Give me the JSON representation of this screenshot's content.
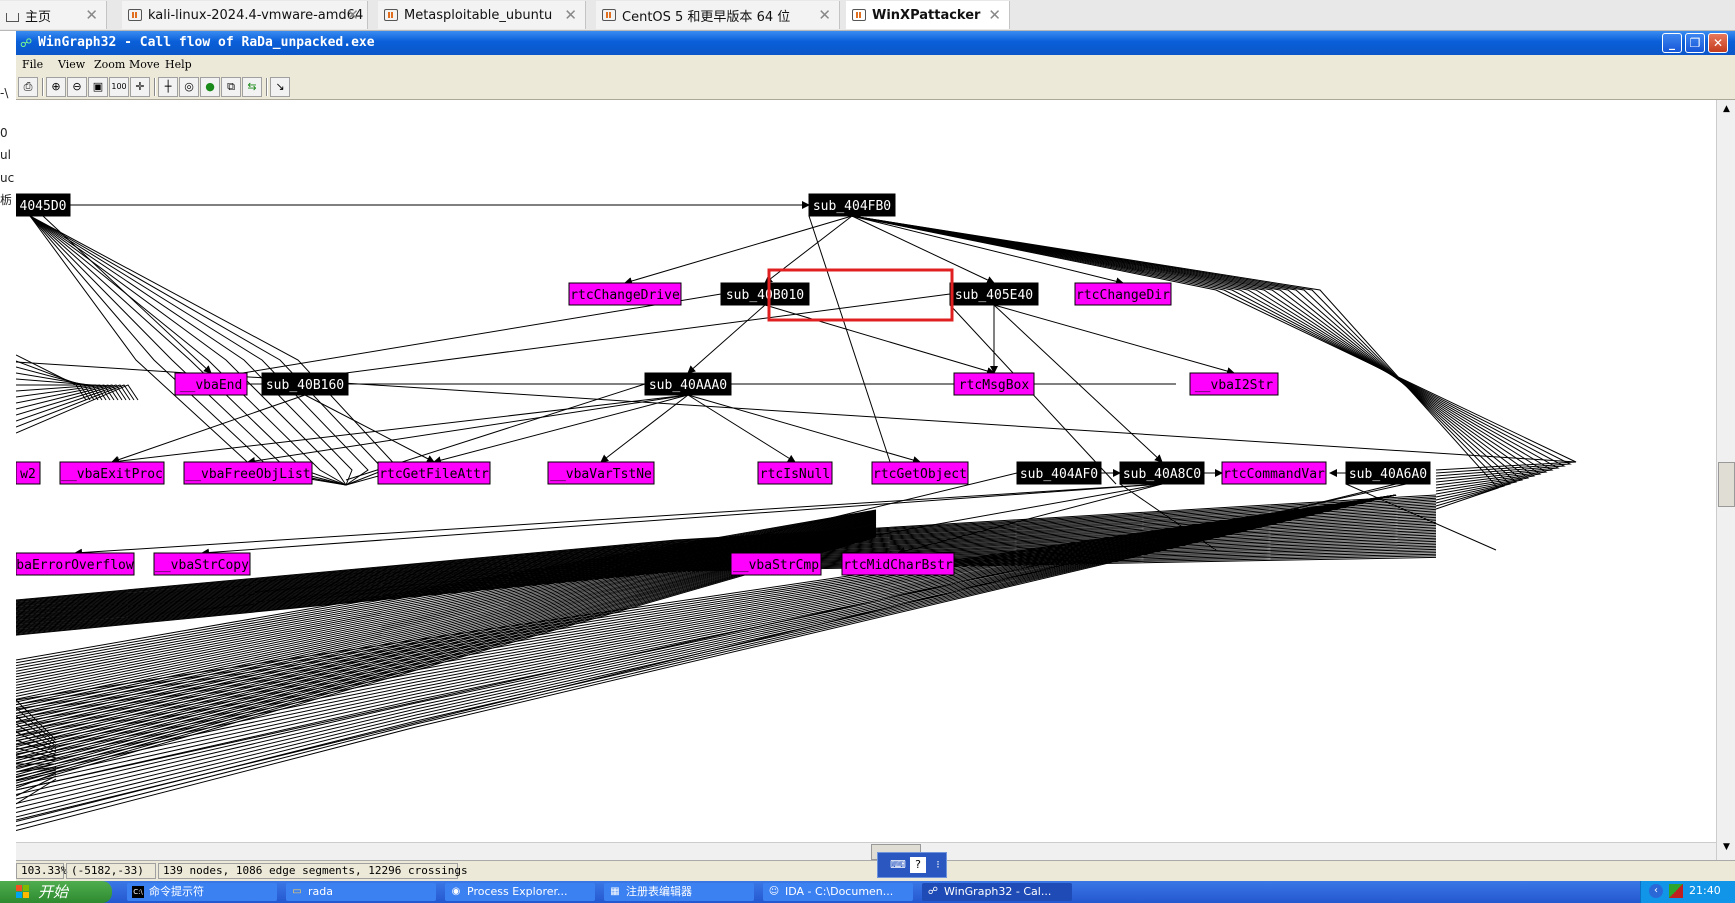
{
  "host_tabs": [
    {
      "label": "主页",
      "icon": "home-icon",
      "active": false
    },
    {
      "label": "kali-linux-2024.4-vmware-amd64",
      "icon": "vm-icon",
      "active": false
    },
    {
      "label": "Metasploitable_ubuntu",
      "icon": "vm-icon",
      "active": false
    },
    {
      "label": "CentOS 5 和更早版本 64 位",
      "icon": "vm-icon",
      "active": false
    },
    {
      "label": "WinXPattacker",
      "icon": "vm-icon",
      "active": true
    }
  ],
  "left_strip": [
    "-\\",
    "0",
    "ul",
    "uc",
    "栃"
  ],
  "window": {
    "title": "WinGraph32 - Call flow of RaDa_unpacked.exe",
    "controls": [
      "minimize",
      "maximize",
      "close"
    ]
  },
  "menu": [
    "File",
    "View",
    "Zoom",
    "Move",
    "Help"
  ],
  "toolbar": [
    {
      "icon": "print-icon",
      "glyph": "⎙"
    },
    {
      "icon": "zoom-in-icon",
      "glyph": "⊕"
    },
    {
      "icon": "zoom-out-icon",
      "glyph": "⊖"
    },
    {
      "icon": "fit-icon",
      "glyph": "▣"
    },
    {
      "icon": "zoom-100-icon",
      "glyph": "100"
    },
    {
      "icon": "move-icon",
      "glyph": "✛"
    },
    {
      "icon": "layout-icon",
      "glyph": "┼"
    },
    {
      "icon": "globe-icon",
      "glyph": "◎"
    },
    {
      "icon": "green-globe-icon",
      "glyph": "●"
    },
    {
      "icon": "window-icon",
      "glyph": "⧉"
    },
    {
      "icon": "green-window-icon",
      "glyph": "⇆"
    },
    {
      "icon": "follow-edge-icon",
      "glyph": "↘"
    }
  ],
  "graph": {
    "highlight_color": "#e02020",
    "function_fill": "#000000",
    "import_fill": "#ff00ff",
    "nodes": [
      {
        "label": "4045D0",
        "kind": "function"
      },
      {
        "label": "sub_404FB0",
        "kind": "function"
      },
      {
        "label": "rtcChangeDrive",
        "kind": "import"
      },
      {
        "label": "sub_40B010",
        "kind": "function",
        "highlighted": true
      },
      {
        "label": "sub_405E40",
        "kind": "function"
      },
      {
        "label": "rtcChangeDir",
        "kind": "import"
      },
      {
        "label": "__vbaEnd",
        "kind": "import"
      },
      {
        "label": "sub_40B160",
        "kind": "function"
      },
      {
        "label": "sub_40AAA0",
        "kind": "function"
      },
      {
        "label": "rtcMsgBox",
        "kind": "import"
      },
      {
        "label": "__vbaI2Str",
        "kind": "import"
      },
      {
        "label": "w2",
        "kind": "import"
      },
      {
        "label": "__vbaExitProc",
        "kind": "import"
      },
      {
        "label": "__vbaFreeObjList",
        "kind": "import"
      },
      {
        "label": "rtcGetFileAttr",
        "kind": "import"
      },
      {
        "label": "__vbaVarTstNe",
        "kind": "import"
      },
      {
        "label": "rtcIsNull",
        "kind": "import"
      },
      {
        "label": "rtcGetObject",
        "kind": "import"
      },
      {
        "label": "sub_404AF0",
        "kind": "function"
      },
      {
        "label": "sub_40A8C0",
        "kind": "function"
      },
      {
        "label": "rtcCommandVar",
        "kind": "import"
      },
      {
        "label": "sub_40A6A0",
        "kind": "function"
      },
      {
        "label": "baErrorOverflow",
        "kind": "import"
      },
      {
        "label": "__vbaStrCopy",
        "kind": "import"
      },
      {
        "label": "__vbaStrCmp",
        "kind": "import"
      },
      {
        "label": "rtcMidCharBstr",
        "kind": "import"
      }
    ]
  },
  "status": {
    "zoom": "103.33%",
    "coords": "(-5182,-33)",
    "summary": "139 nodes, 1086 edge segments, 12296 crossings"
  },
  "taskbar": {
    "start_label": "开始",
    "tasks": [
      {
        "label": "命令提示符",
        "icon": "cmd-icon",
        "glyph": "C:\\"
      },
      {
        "label": "rada",
        "icon": "folder-icon",
        "glyph": "▭"
      },
      {
        "label": "Process Explorer...",
        "icon": "process-explorer-icon",
        "glyph": "◉"
      },
      {
        "label": "注册表编辑器",
        "icon": "regedit-icon",
        "glyph": "▦"
      },
      {
        "label": "IDA - C:\\Documen...",
        "icon": "ida-icon",
        "glyph": "☺"
      },
      {
        "label": "WinGraph32 - Cal...",
        "icon": "wingraph-icon",
        "glyph": "☍"
      }
    ],
    "clock": "21:40"
  }
}
